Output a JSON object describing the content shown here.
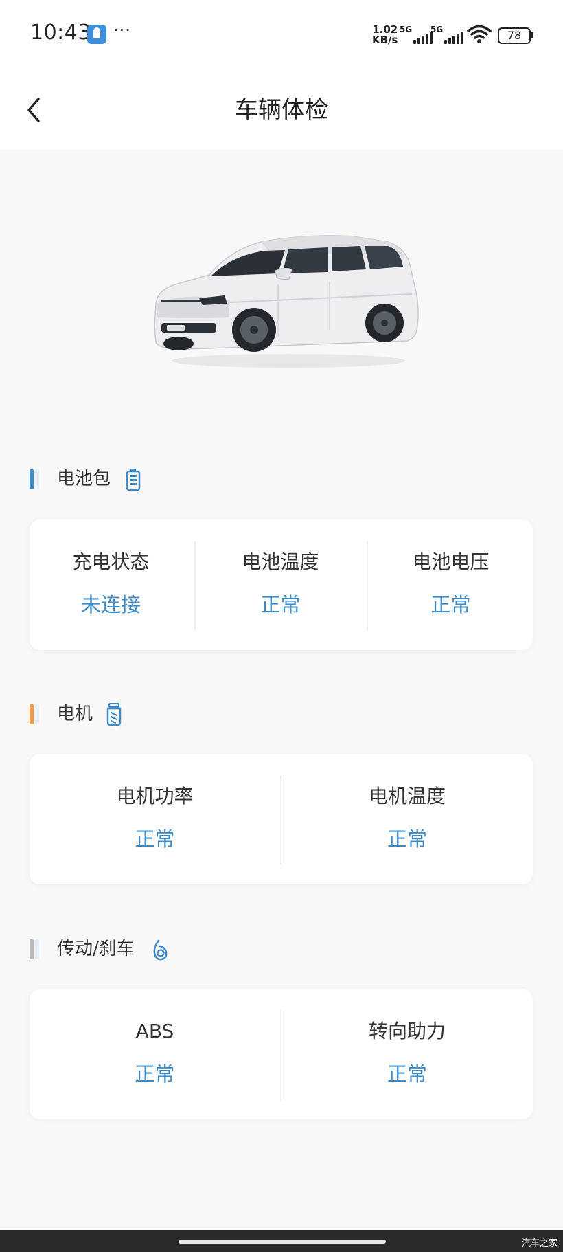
{
  "status_bar": {
    "time": "10:43",
    "app_icon": "app-notification-icon",
    "more": "···",
    "net_speed_value": "1.02",
    "net_speed_unit": "KB/s",
    "signal_1_type": "5G",
    "signal_2_type": "5G",
    "battery": "78"
  },
  "header": {
    "title": "车辆体检",
    "back_icon": "chevron-left-icon"
  },
  "vehicle": {
    "image": "car-image"
  },
  "sections": {
    "battery": {
      "title": "电池包",
      "accent": "#3c8bc7",
      "icon": "battery-icon",
      "items": [
        {
          "label": "充电状态",
          "value": "未连接"
        },
        {
          "label": "电池温度",
          "value": "正常"
        },
        {
          "label": "电池电压",
          "value": "正常"
        }
      ]
    },
    "motor": {
      "title": "电机",
      "accent": "#ee9a46",
      "icon": "motor-icon",
      "items": [
        {
          "label": "电机功率",
          "value": "正常"
        },
        {
          "label": "电机温度",
          "value": "正常"
        }
      ]
    },
    "drive": {
      "title": "传动/刹车",
      "accent": "#b9b9b9",
      "icon": "brake-icon",
      "items": [
        {
          "label": "ABS",
          "value": "正常"
        },
        {
          "label": "转向助力",
          "value": "正常"
        }
      ]
    }
  },
  "value_color": "#3c8bc7",
  "footer": {
    "watermark": "汽车之家"
  }
}
